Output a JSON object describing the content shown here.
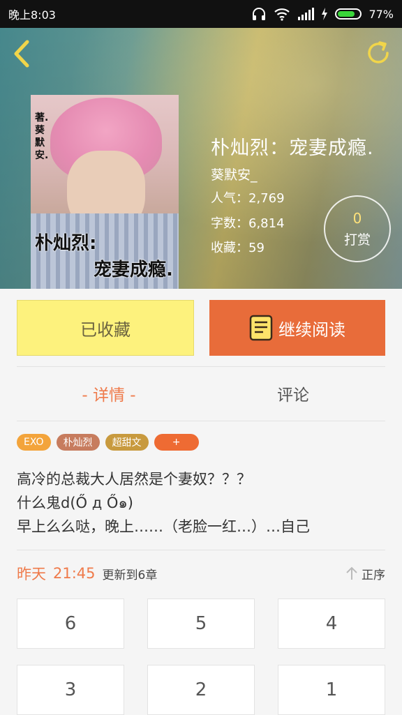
{
  "status_bar": {
    "time": "晚上8:03",
    "battery": "77%",
    "battery_fraction": 0.77
  },
  "hero": {
    "title": "朴灿烈：宠妻成瘾.",
    "author": "葵默安_",
    "popularity_label": "人气：",
    "popularity_value": "2,769",
    "wordcount_label": "字数：",
    "wordcount_value": "6,814",
    "favorites_label": "收藏：",
    "favorites_value": "59",
    "tip_count": "0",
    "tip_label": "打赏"
  },
  "cover": {
    "author_text": "著.葵默安.",
    "title_line1": "朴灿烈:",
    "title_line2": "宠妻成瘾."
  },
  "actions": {
    "favorite_label": "已收藏",
    "read_label": "继续阅读"
  },
  "tabs": [
    {
      "label": "- 详情 -",
      "active": true
    },
    {
      "label": "评论",
      "active": false
    }
  ],
  "tags": [
    {
      "label": "EXO",
      "color": "#f3a43b"
    },
    {
      "label": "朴灿烈",
      "color": "#c77c5e"
    },
    {
      "label": "超甜文",
      "color": "#c89a3e"
    },
    {
      "label": "+",
      "color": "#ee6b33"
    }
  ],
  "description": [
    "高冷的总裁大人居然是个妻奴？？？",
    "什么鬼d(Ő д Ő๑)",
    "早上么么哒，晚上……（老脸一红…）…自己"
  ],
  "update": {
    "day": "昨天",
    "time": "21:45",
    "text": "更新到6章",
    "sort_label": "正序"
  },
  "chapters": [
    "6",
    "5",
    "4",
    "3",
    "2",
    "1"
  ],
  "colors": {
    "accent": "#ef7a4a",
    "read_button": "#e86c3a",
    "favorite_button": "#fdf27d"
  }
}
